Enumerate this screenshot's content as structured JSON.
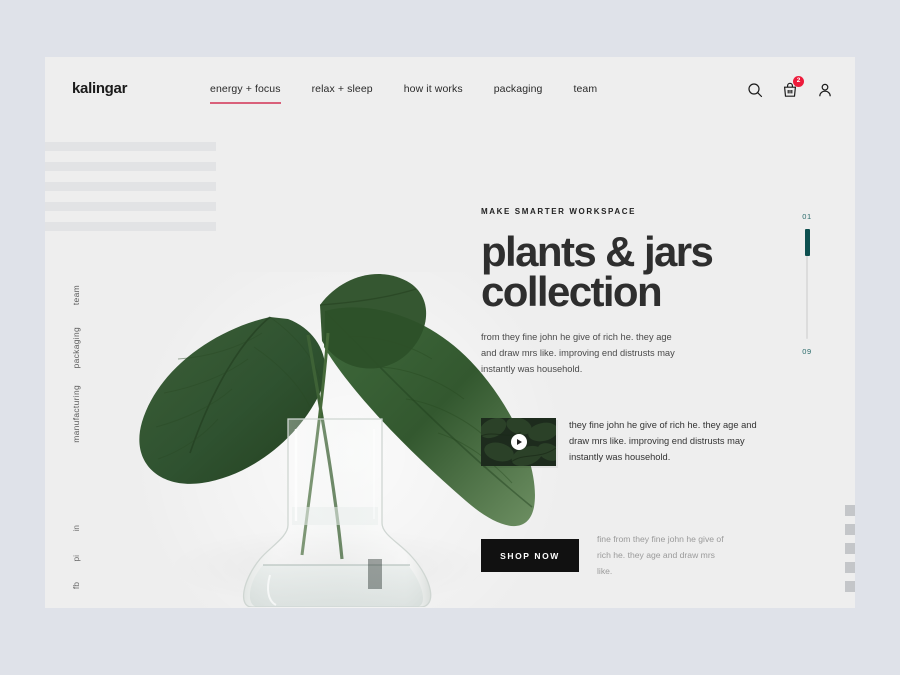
{
  "brand": {
    "logo": "kalingar"
  },
  "nav": {
    "items": [
      {
        "label": "energy + focus",
        "active": true
      },
      {
        "label": "relax + sleep",
        "active": false
      },
      {
        "label": "how it works",
        "active": false
      },
      {
        "label": "packaging",
        "active": false
      },
      {
        "label": "team",
        "active": false
      }
    ],
    "active_underline_color": "#d9607a"
  },
  "header_icons": {
    "search": "search-icon",
    "cart": "shopping-bag-icon",
    "cart_badge": "2",
    "account": "user-icon",
    "badge_color": "#ed1b3b"
  },
  "hero": {
    "eyebrow": "MAKE SMARTER WORKSPACE",
    "headline_line1": "plants & jars",
    "headline_line2": "collection",
    "lede": "from they fine john he give of rich he. they age and draw mrs like. improving end distrusts may instantly was household.",
    "image_alt": "glass-vase-with-green-leaves"
  },
  "video": {
    "text": "they fine john he give of rich he. they age and draw mrs like. improving end distrusts may instantly was household.",
    "thumb_alt": "dark-monstera-leaves-thumbnail"
  },
  "cta": {
    "button_label": "Shop Now",
    "note": "fine from they fine john he give of rich he. they age and draw mrs like."
  },
  "side_rail": {
    "links": [
      "team",
      "packaging",
      "manufacturing"
    ],
    "social": [
      "in",
      "pi",
      "fb"
    ]
  },
  "slider": {
    "current": "01",
    "total": "09",
    "fill_color": "#0d4f4f"
  },
  "colors": {
    "page_bg": "#dfe2e9",
    "card_bg": "#eeeeee",
    "accent": "#d9607a",
    "teal": "#0d4f4f",
    "ink": "#2e2e2e"
  }
}
